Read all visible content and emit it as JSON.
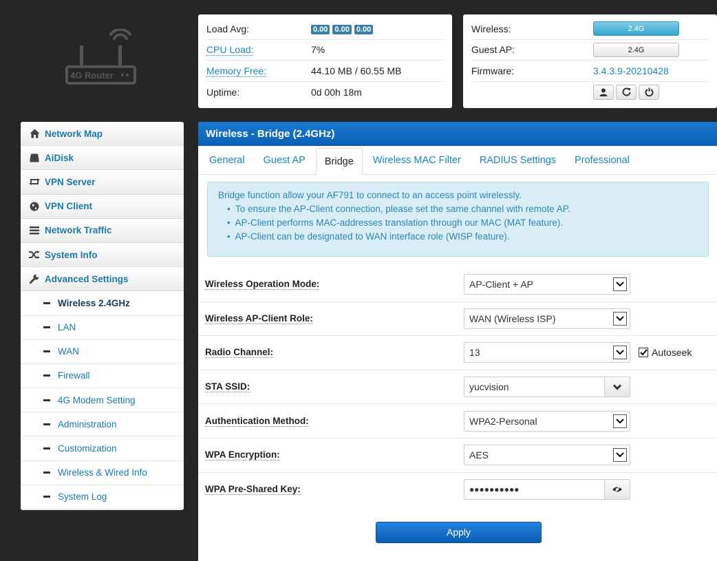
{
  "logo": {
    "text": "4G Router"
  },
  "status_left": {
    "load_avg_label": "Load Avg:",
    "load_values": [
      "0.00",
      "0.00",
      "0.00"
    ],
    "cpu_label": "CPU Load:",
    "cpu_value": "7%",
    "mem_label": "Memory Free:",
    "mem_value": "44.10 MB / 60.55 MB",
    "uptime_label": "Uptime:",
    "uptime_value": "0d 00h 18m"
  },
  "status_right": {
    "wireless_label": "Wireless:",
    "wireless_value": "2.4G",
    "guest_label": "Guest AP:",
    "guest_value": "2.4G",
    "firmware_label": "Firmware:",
    "firmware_value": "3.4.3.9-20210428"
  },
  "sidebar": {
    "items": [
      {
        "label": "Network Map",
        "icon": "home-icon"
      },
      {
        "label": "AiDisk",
        "icon": "disk-icon"
      },
      {
        "label": "VPN Server",
        "icon": "retweet-icon"
      },
      {
        "label": "VPN Client",
        "icon": "globe-icon"
      },
      {
        "label": "Network Traffic",
        "icon": "list-icon"
      },
      {
        "label": "System Info",
        "icon": "shuffle-icon"
      },
      {
        "label": "Advanced Settings",
        "icon": "wrench-icon"
      }
    ],
    "subitems": [
      "Wireless 2.4GHz",
      "LAN",
      "WAN",
      "Firewall",
      "4G Modem Setting",
      "Administration",
      "Customization",
      "Wireless & Wired Info",
      "System Log"
    ]
  },
  "main": {
    "title": "Wireless - Bridge (2.4GHz)",
    "tabs": [
      "General",
      "Guest AP",
      "Bridge",
      "Wireless MAC Filter",
      "RADIUS Settings",
      "Professional"
    ],
    "active_tab": "Bridge",
    "info": {
      "heading": "Bridge function allow your AF791 to connect to an access point wirelessly.",
      "bullets": [
        "To ensure the AP-Client connection, please set the same channel with remote AP.",
        "AP-Client performs MAC-addresses translation through our MAC (MAT feature).",
        "AP-Client can be designated to WAN interface role (WISP feature)."
      ]
    },
    "form": {
      "op_mode_label": "Wireless Operation Mode:",
      "op_mode_value": "AP-Client + AP",
      "role_label": "Wireless AP-Client Role:",
      "role_value": "WAN (Wireless ISP)",
      "channel_label": "Radio Channel:",
      "channel_value": "13",
      "autoseek_label": "Autoseek",
      "ssid_label": "STA SSID:",
      "ssid_value": "yucvision",
      "auth_label": "Authentication Method:",
      "auth_value": "WPA2-Personal",
      "enc_label": "WPA Encryption:",
      "enc_value": "AES",
      "psk_label": "WPA Pre-Shared Key:",
      "psk_value": "●●●●●●●●●●"
    },
    "apply_label": "Apply"
  }
}
